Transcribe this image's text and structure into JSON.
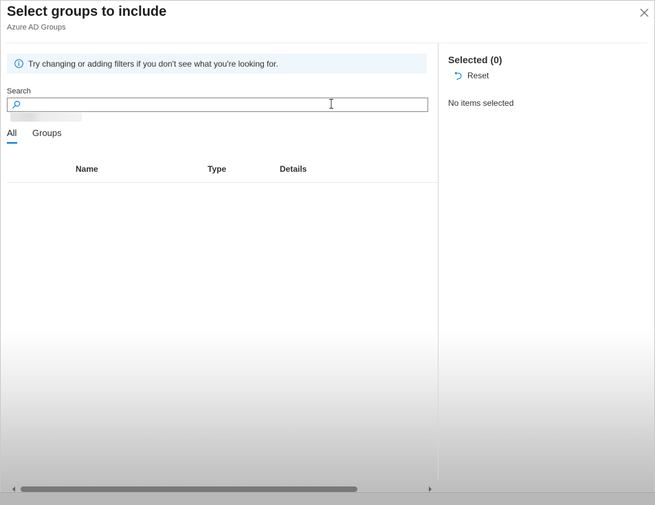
{
  "header": {
    "title": "Select groups to include",
    "subtitle": "Azure AD Groups"
  },
  "info": {
    "message": "Try changing or adding filters if you don't see what you're looking for.",
    "icon": "info-icon"
  },
  "search": {
    "label": "Search",
    "value": "",
    "placeholder": "",
    "icon": "search-icon"
  },
  "tabs": [
    {
      "label": "All",
      "active": true
    },
    {
      "label": "Groups",
      "active": false
    }
  ],
  "table": {
    "columns": [
      "Name",
      "Type",
      "Details"
    ],
    "rows": []
  },
  "selected": {
    "heading": "Selected (0)",
    "reset_label": "Reset",
    "empty_message": "No items selected"
  },
  "colors": {
    "accent": "#0078d4",
    "info_background": "#eff6fc"
  }
}
